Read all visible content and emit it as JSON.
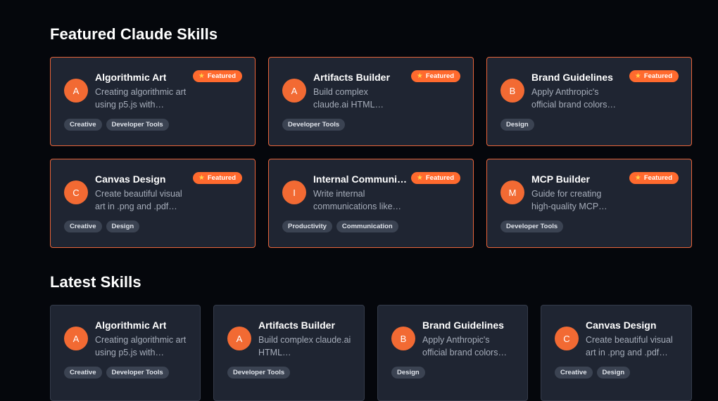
{
  "featured": {
    "title": "Featured Claude Skills",
    "badge_label": "Featured",
    "cards": [
      {
        "initial": "A",
        "name": "Algorithmic Art",
        "desc": "Creating algorithmic art using p5.js with…",
        "tags": [
          "Creative",
          "Developer Tools"
        ]
      },
      {
        "initial": "A",
        "name": "Artifacts Builder",
        "desc": "Build complex claude.ai HTML…",
        "tags": [
          "Developer Tools"
        ]
      },
      {
        "initial": "B",
        "name": "Brand Guidelines",
        "desc": "Apply Anthropic's official brand colors…",
        "tags": [
          "Design"
        ]
      },
      {
        "initial": "C",
        "name": "Canvas Design",
        "desc": "Create beautiful visual art in .png and .pdf…",
        "tags": [
          "Creative",
          "Design"
        ]
      },
      {
        "initial": "I",
        "name": "Internal Communi…",
        "desc": "Write internal communications like…",
        "tags": [
          "Productivity",
          "Communication"
        ]
      },
      {
        "initial": "M",
        "name": "MCP Builder",
        "desc": "Guide for creating high-quality MCP…",
        "tags": [
          "Developer Tools"
        ]
      }
    ]
  },
  "latest": {
    "title": "Latest Skills",
    "cards": [
      {
        "initial": "A",
        "name": "Algorithmic Art",
        "desc": "Creating algorithmic art using p5.js with…",
        "tags": [
          "Creative",
          "Developer Tools"
        ]
      },
      {
        "initial": "A",
        "name": "Artifacts Builder",
        "desc": "Build complex claude.ai HTML…",
        "tags": [
          "Developer Tools"
        ]
      },
      {
        "initial": "B",
        "name": "Brand Guidelines",
        "desc": "Apply Anthropic's official brand colors…",
        "tags": [
          "Design"
        ]
      },
      {
        "initial": "C",
        "name": "Canvas Design",
        "desc": "Create beautiful visual art in .png and .pdf…",
        "tags": [
          "Creative",
          "Design"
        ]
      }
    ]
  },
  "colors": {
    "background": "#05070c",
    "card": "#1f2532",
    "accent": "#ff6a2e",
    "tag": "#3b4352"
  },
  "icons": {
    "featured_badge": "star-icon"
  }
}
